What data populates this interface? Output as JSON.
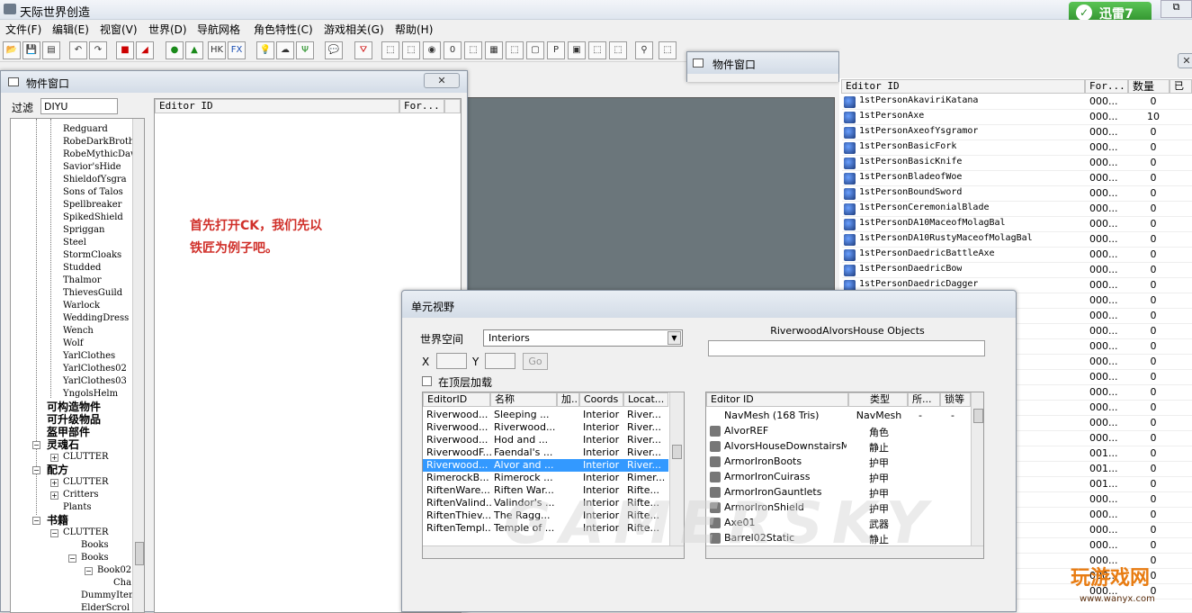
{
  "app": {
    "title": "天际世界创造",
    "window_control": "⧉"
  },
  "xunlei": {
    "label": "迅雷7",
    "glyph": "✓"
  },
  "menu": [
    "文件(F)",
    "编辑(E)",
    "视窗(V)",
    "世界(D)",
    "导航网格",
    "角色特性(C)",
    "游戏相关(G)",
    "帮助(H)"
  ],
  "left_window": {
    "title": "物件窗口",
    "filter_label": "过滤",
    "filter_value": "DIYU",
    "columns": [
      "Editor ID",
      "For..."
    ],
    "tree": [
      "Redguard",
      "RobeDarkBroth",
      "RobeMythicDaw",
      "Savior'sHide",
      "ShieldofYsgra",
      "Sons of Talos",
      "Spellbreaker",
      "SpikedShield",
      "Spriggan",
      "Steel",
      "StormCloaks",
      "Studded",
      "Thalmor",
      "ThievesGuild",
      "Warlock",
      "WeddingDress",
      "Wench",
      "Wolf",
      "YarlClothes",
      "YarlClothes02",
      "YarlClothes03",
      "YngolsHelm"
    ],
    "categories": [
      "可构造物件",
      "可升级物品",
      "盔甲部件",
      "灵魂石",
      "配方",
      "书籍"
    ],
    "tree_clutter": "CLUTTER",
    "tree_critters": "Critters",
    "tree_plants": "Plants",
    "tree_books": [
      "Books",
      "Books",
      "Book02",
      "Cha",
      "DummyItems",
      "ElderScrol"
    ],
    "annotation": "首先打开CK，我们先以\n铁匠为例子吧。"
  },
  "right_window": {
    "title": "物件窗口",
    "columns": [
      "Editor ID",
      "For...",
      "数量",
      "已"
    ],
    "rows": [
      {
        "id": "1stPersonAkaviriKatana",
        "form": "000...",
        "count": "0"
      },
      {
        "id": "1stPersonAxe",
        "form": "000...",
        "count": "10"
      },
      {
        "id": "1stPersonAxeofYsgramor",
        "form": "000...",
        "count": "0"
      },
      {
        "id": "1stPersonBasicFork",
        "form": "000...",
        "count": "0"
      },
      {
        "id": "1stPersonBasicKnife",
        "form": "000...",
        "count": "0"
      },
      {
        "id": "1stPersonBladeofWoe",
        "form": "000...",
        "count": "0"
      },
      {
        "id": "1stPersonBoundSword",
        "form": "000...",
        "count": "0"
      },
      {
        "id": "1stPersonCeremonialBlade",
        "form": "000...",
        "count": "0"
      },
      {
        "id": "1stPersonDA10MaceofMolagBal",
        "form": "000...",
        "count": "0"
      },
      {
        "id": "1stPersonDA10RustyMaceofMolagBal",
        "form": "000...",
        "count": "0"
      },
      {
        "id": "1stPersonDaedricBattleAxe",
        "form": "000...",
        "count": "0"
      },
      {
        "id": "1stPersonDaedricBow",
        "form": "000...",
        "count": "0"
      },
      {
        "id": "1stPersonDaedricDagger",
        "form": "000...",
        "count": "0"
      }
    ],
    "tail_rows": [
      {
        "form": "000...",
        "count": "0"
      },
      {
        "form": "000...",
        "count": "0"
      },
      {
        "form": "000...",
        "count": "0"
      },
      {
        "form": "000...",
        "count": "0"
      },
      {
        "form": "000...",
        "count": "0"
      },
      {
        "form": "000...",
        "count": "0"
      },
      {
        "form": "000...",
        "count": "0"
      },
      {
        "form": "000...",
        "count": "0"
      },
      {
        "form": "000...",
        "count": "0"
      },
      {
        "form": "000...",
        "count": "0"
      },
      {
        "form": "001...",
        "count": "0"
      },
      {
        "form": "001...",
        "count": "0"
      },
      {
        "form": "001...",
        "count": "0"
      },
      {
        "form": "000...",
        "count": "0"
      },
      {
        "form": "000...",
        "count": "0"
      },
      {
        "form": "000...",
        "count": "0"
      },
      {
        "form": "000...",
        "count": "0"
      },
      {
        "form": "000...",
        "count": "0"
      },
      {
        "form": "000...",
        "count": "0"
      },
      {
        "form": "000...",
        "count": "0"
      }
    ]
  },
  "cell_view": {
    "title": "单元视野",
    "worldspace_label": "世界空间",
    "worldspace_value": "Interiors",
    "x_label": "X",
    "y_label": "Y",
    "go_label": "Go",
    "load_top_label": "在顶层加载",
    "objects_header": "RiverwoodAlvorsHouse Objects",
    "cell_columns": [
      "EditorID",
      "名称",
      "加...",
      "Coords",
      "Locat..."
    ],
    "cell_rows": [
      [
        "Riverwood...",
        "Sleeping ...",
        "",
        "Interior",
        "River..."
      ],
      [
        "Riverwood...",
        "Riverwood...",
        "",
        "Interior",
        "River..."
      ],
      [
        "Riverwood...",
        "Hod and ...",
        "",
        "Interior",
        "River..."
      ],
      [
        "RiverwoodF...",
        "Faendal's ...",
        "",
        "Interior",
        "River..."
      ],
      [
        "Riverwood...",
        "Alvor and ...",
        "",
        "Interior",
        "River..."
      ],
      [
        "RimerockB...",
        "Rimerock ...",
        "",
        "Interior",
        "Rimer..."
      ],
      [
        "RiftenWare...",
        "Riften War...",
        "",
        "Interior",
        "Rifte..."
      ],
      [
        "RiftenValind...",
        "Valindor's ...",
        "",
        "Interior",
        "Rifte..."
      ],
      [
        "RiftenThiev...",
        "The Ragg...",
        "",
        "Interior",
        "Rifte..."
      ],
      [
        "RiftenTempl...",
        "Temple of ...",
        "",
        "Interior",
        "Rifte..."
      ]
    ],
    "selected_row": 4,
    "obj_columns": [
      "Editor ID",
      "类型",
      "所...",
      "锁等"
    ],
    "obj_rows": [
      {
        "id": "NavMesh (168 Tris)",
        "type": "NavMesh",
        "o": "-",
        "l": "-"
      },
      {
        "id": "AlvorREF",
        "type": "角色",
        "o": "",
        "l": ""
      },
      {
        "id": "AlvorsHouseDownstairsMa...",
        "type": "静止",
        "o": "",
        "l": ""
      },
      {
        "id": "ArmorIronBoots",
        "type": "护甲",
        "o": "",
        "l": ""
      },
      {
        "id": "ArmorIronCuirass",
        "type": "护甲",
        "o": "",
        "l": ""
      },
      {
        "id": "ArmorIronGauntlets",
        "type": "护甲",
        "o": "",
        "l": ""
      },
      {
        "id": "ArmorIronShield",
        "type": "护甲",
        "o": "",
        "l": ""
      },
      {
        "id": "Axe01",
        "type": "武器",
        "o": "",
        "l": ""
      },
      {
        "id": "Barrel02Static",
        "type": "静止",
        "o": "",
        "l": ""
      }
    ]
  },
  "watermark": {
    "site": "GAMERSKY",
    "logo": "玩游戏网",
    "url": "www.wanyx.com"
  }
}
